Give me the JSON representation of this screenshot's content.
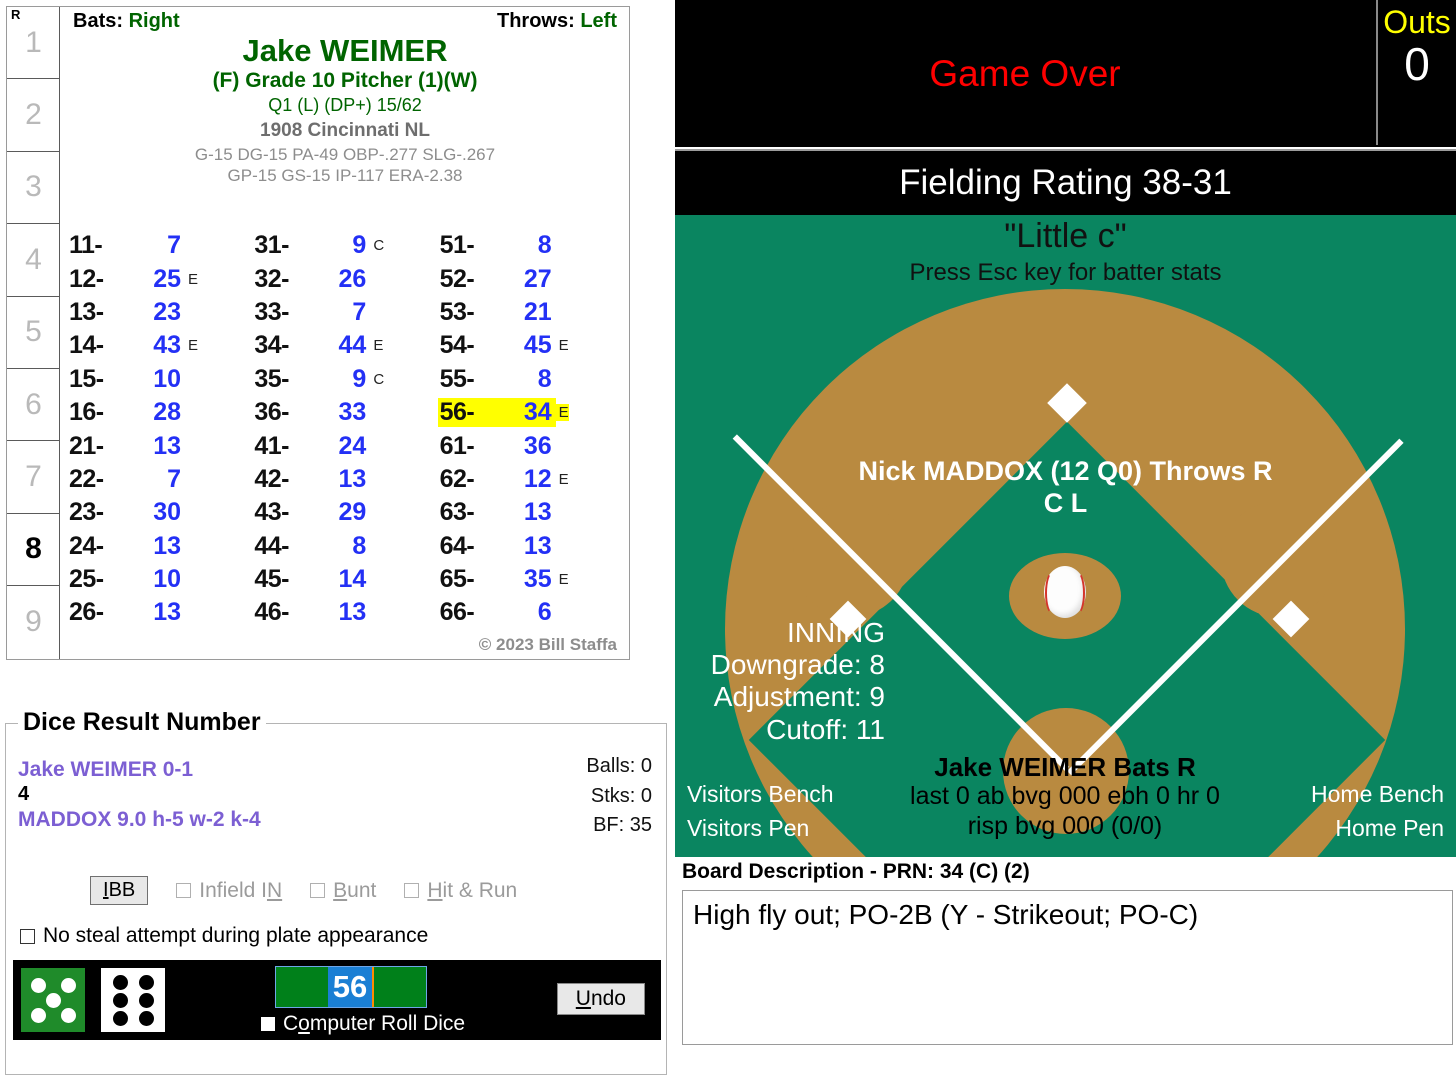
{
  "inning_column": {
    "runs_header": "R",
    "innings": [
      "1",
      "2",
      "3",
      "4",
      "5",
      "6",
      "7",
      "8",
      "9"
    ],
    "active_inning": "8"
  },
  "player_card": {
    "bats_label": "Bats:",
    "bats_value": "Right",
    "throws_label": "Throws:",
    "throws_value": "Left",
    "name": "Jake WEIMER",
    "grade": "(F) Grade 10 Pitcher (1)(W)",
    "quality": "Q1 (L) (DP+) 15/62",
    "team": "1908 Cincinnati NL",
    "stat_line_1": "G-15 DG-15 PA-49 OBP-.277 SLG-.267",
    "stat_line_2": "GP-15 GS-15 IP-117 ERA-2.38",
    "copyright": "© 2023 Bill Staffa",
    "roll_columns": [
      [
        {
          "key": "11-",
          "value": "7",
          "flag": ""
        },
        {
          "key": "12-",
          "value": "25",
          "flag": "E"
        },
        {
          "key": "13-",
          "value": "23",
          "flag": ""
        },
        {
          "key": "14-",
          "value": "43",
          "flag": "E"
        },
        {
          "key": "15-",
          "value": "10",
          "flag": ""
        },
        {
          "key": "16-",
          "value": "28",
          "flag": ""
        },
        {
          "key": "21-",
          "value": "13",
          "flag": ""
        },
        {
          "key": "22-",
          "value": "7",
          "flag": ""
        },
        {
          "key": "23-",
          "value": "30",
          "flag": ""
        },
        {
          "key": "24-",
          "value": "13",
          "flag": ""
        },
        {
          "key": "25-",
          "value": "10",
          "flag": ""
        },
        {
          "key": "26-",
          "value": "13",
          "flag": ""
        }
      ],
      [
        {
          "key": "31-",
          "value": "9",
          "flag": "C"
        },
        {
          "key": "32-",
          "value": "26",
          "flag": ""
        },
        {
          "key": "33-",
          "value": "7",
          "flag": ""
        },
        {
          "key": "34-",
          "value": "44",
          "flag": "E"
        },
        {
          "key": "35-",
          "value": "9",
          "flag": "C"
        },
        {
          "key": "36-",
          "value": "33",
          "flag": ""
        },
        {
          "key": "41-",
          "value": "24",
          "flag": ""
        },
        {
          "key": "42-",
          "value": "13",
          "flag": ""
        },
        {
          "key": "43-",
          "value": "29",
          "flag": ""
        },
        {
          "key": "44-",
          "value": "8",
          "flag": ""
        },
        {
          "key": "45-",
          "value": "14",
          "flag": ""
        },
        {
          "key": "46-",
          "value": "13",
          "flag": ""
        }
      ],
      [
        {
          "key": "51-",
          "value": "8",
          "flag": ""
        },
        {
          "key": "52-",
          "value": "27",
          "flag": ""
        },
        {
          "key": "53-",
          "value": "21",
          "flag": ""
        },
        {
          "key": "54-",
          "value": "45",
          "flag": "E"
        },
        {
          "key": "55-",
          "value": "8",
          "flag": ""
        },
        {
          "key": "56-",
          "value": "34",
          "flag": "E",
          "highlight": true
        },
        {
          "key": "61-",
          "value": "36",
          "flag": ""
        },
        {
          "key": "62-",
          "value": "12",
          "flag": "E"
        },
        {
          "key": "63-",
          "value": "13",
          "flag": ""
        },
        {
          "key": "64-",
          "value": "13",
          "flag": ""
        },
        {
          "key": "65-",
          "value": "35",
          "flag": "E"
        },
        {
          "key": "66-",
          "value": "6",
          "flag": ""
        }
      ]
    ]
  },
  "dice_panel": {
    "legend": "Dice Result Number",
    "pitcher_record": "Jake WEIMER  0-1",
    "count_number": "4",
    "pitcher_line": "MADDOX  9.0  h-5  w-2  k-4",
    "balls": "Balls: 0",
    "strikes": "Stks: 0",
    "batters_faced": "BF: 35",
    "ibb_label": "IBB",
    "infield_in_label": "Infield IN",
    "bunt_label": "Bunt",
    "hit_run_label": "Hit & Run",
    "no_steal_label": "No steal attempt during plate appearance",
    "roll_value": "56",
    "computer_roll_label": "Computer Roll Dice",
    "undo_label": "Undo",
    "green_die_pips": 5,
    "white_die_pips": 6,
    "highlight_color": "#ffff00"
  },
  "scoreboard": {
    "game_status": "Game Over",
    "outs_label": "Outs",
    "outs_value": "0",
    "fielding_rating": "Fielding Rating 38-31",
    "status_color": "#ff0000",
    "outs_label_color": "#ffff00"
  },
  "field": {
    "park_name": "\"Little c\"",
    "hint": "Press Esc key for batter stats",
    "pitcher_label_line1": "Nick MADDOX (12 Q0) Throws R",
    "pitcher_label_line2": "C L",
    "inning_heading": "INNING",
    "downgrade": "Downgrade: 8",
    "adjustment": "Adjustment: 9",
    "cutoff": "Cutoff: 11",
    "batter_name": "Jake WEIMER Bats R",
    "batter_stat_1": "last 0 ab bvg 000 ebh 0 hr 0",
    "batter_stat_2": "risp bvg 000 (0/0)",
    "visitors_bench": "Visitors Bench",
    "visitors_pen": "Visitors Pen",
    "home_bench": "Home Bench",
    "home_pen": "Home Pen",
    "grass_color": "#0a8560",
    "dirt_color": "#b98a40"
  },
  "board": {
    "legend": "Board Description - PRN: 34 (C) (2)",
    "description": "High fly out; PO-2B (Y - Strikeout; PO-C)"
  }
}
